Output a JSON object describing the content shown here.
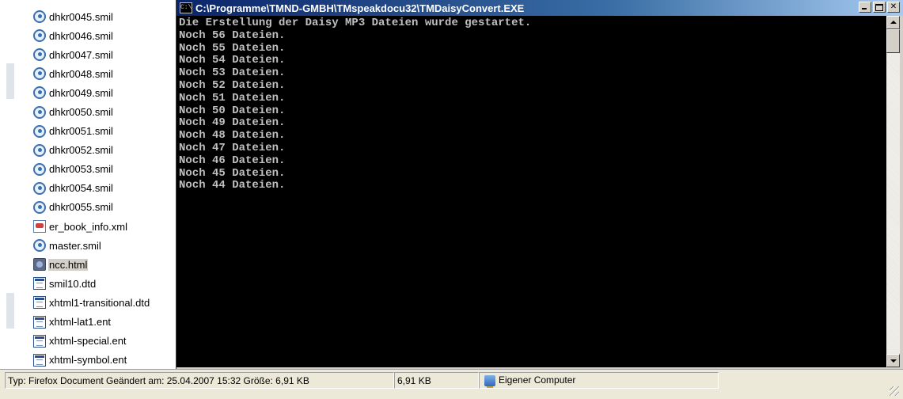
{
  "explorer": {
    "files": [
      {
        "name": "dhkr0045.smil",
        "icon": "smil-file-icon",
        "selected": false
      },
      {
        "name": "dhkr0046.smil",
        "icon": "smil-file-icon",
        "selected": false
      },
      {
        "name": "dhkr0047.smil",
        "icon": "smil-file-icon",
        "selected": false
      },
      {
        "name": "dhkr0048.smil",
        "icon": "smil-file-icon",
        "selected": false
      },
      {
        "name": "dhkr0049.smil",
        "icon": "smil-file-icon",
        "selected": false
      },
      {
        "name": "dhkr0050.smil",
        "icon": "smil-file-icon",
        "selected": false
      },
      {
        "name": "dhkr0051.smil",
        "icon": "smil-file-icon",
        "selected": false
      },
      {
        "name": "dhkr0052.smil",
        "icon": "smil-file-icon",
        "selected": false
      },
      {
        "name": "dhkr0053.smil",
        "icon": "smil-file-icon",
        "selected": false
      },
      {
        "name": "dhkr0054.smil",
        "icon": "smil-file-icon",
        "selected": false
      },
      {
        "name": "dhkr0055.smil",
        "icon": "smil-file-icon",
        "selected": false
      },
      {
        "name": "er_book_info.xml",
        "icon": "xml-file-icon",
        "selected": false
      },
      {
        "name": "master.smil",
        "icon": "smil-file-icon",
        "selected": false
      },
      {
        "name": "ncc.html",
        "icon": "html-file-icon",
        "selected": true
      },
      {
        "name": "smil10.dtd",
        "icon": "dtd-file-icon",
        "selected": false
      },
      {
        "name": "xhtml1-transitional.dtd",
        "icon": "dtd-file-icon",
        "selected": false
      },
      {
        "name": "xhtml-lat1.ent",
        "icon": "dtd-file-icon",
        "selected": false
      },
      {
        "name": "xhtml-special.ent",
        "icon": "dtd-file-icon",
        "selected": false
      },
      {
        "name": "xhtml-symbol.ent",
        "icon": "dtd-file-icon",
        "selected": false
      }
    ]
  },
  "console": {
    "icon": "cmd-icon",
    "icon_text": "C:\\",
    "title": "C:\\Programme\\TMND-GMBH\\TMspeakdocu32\\TMDaisyConvert.EXE",
    "lines": [
      "Die Erstellung der Daisy MP3 Dateien wurde gestartet.",
      "Noch 56 Dateien.",
      "Noch 55 Dateien.",
      "Noch 54 Dateien.",
      "Noch 53 Dateien.",
      "Noch 52 Dateien.",
      "Noch 51 Dateien.",
      "Noch 50 Dateien.",
      "Noch 49 Dateien.",
      "Noch 48 Dateien.",
      "Noch 47 Dateien.",
      "Noch 46 Dateien.",
      "Noch 45 Dateien.",
      "Noch 44 Dateien."
    ],
    "text_color": "#c0c0c0",
    "background_color": "#000000"
  },
  "status_bar": {
    "type_text": "Typ: Firefox Document Geändert am: 25.04.2007 15:32 Größe: 6,91 KB",
    "size_text": "6,91 KB",
    "zone_text": "Eigener Computer",
    "zone_icon": "computer-icon"
  }
}
